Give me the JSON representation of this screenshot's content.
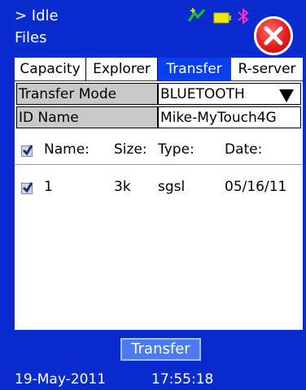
{
  "header": {
    "status": "> Idle",
    "title": "Files",
    "icons": [
      "signal-icon",
      "battery-icon",
      "bluetooth-icon"
    ],
    "close_icon": "close-icon"
  },
  "tabs": [
    {
      "label": "Capacity",
      "active": false
    },
    {
      "label": "Explorer",
      "active": false
    },
    {
      "label": "Transfer",
      "active": true
    },
    {
      "label": "R-server",
      "active": false
    }
  ],
  "settings": {
    "transfer_mode_label": "Transfer Mode",
    "transfer_mode_value": "BLUETOOTH",
    "id_name_label": "ID Name",
    "id_name_value": "Mike-MyTouch4G"
  },
  "file_table": {
    "headers": {
      "name": "Name:",
      "size": "Size:",
      "type": "Type:",
      "date": "Date:"
    },
    "select_all_checked": true,
    "rows": [
      {
        "checked": true,
        "name": "1",
        "size": "3k",
        "type": "sgsl",
        "date": "05/16/11"
      }
    ]
  },
  "actions": {
    "transfer_label": "Transfer"
  },
  "footer": {
    "date": "19-May-2011",
    "time": "17:55:18"
  },
  "colors": {
    "background": "#0a2ccf",
    "active_tab": "#0a3ff0",
    "button": "#4a7bf2",
    "close": "#e21e1e"
  }
}
